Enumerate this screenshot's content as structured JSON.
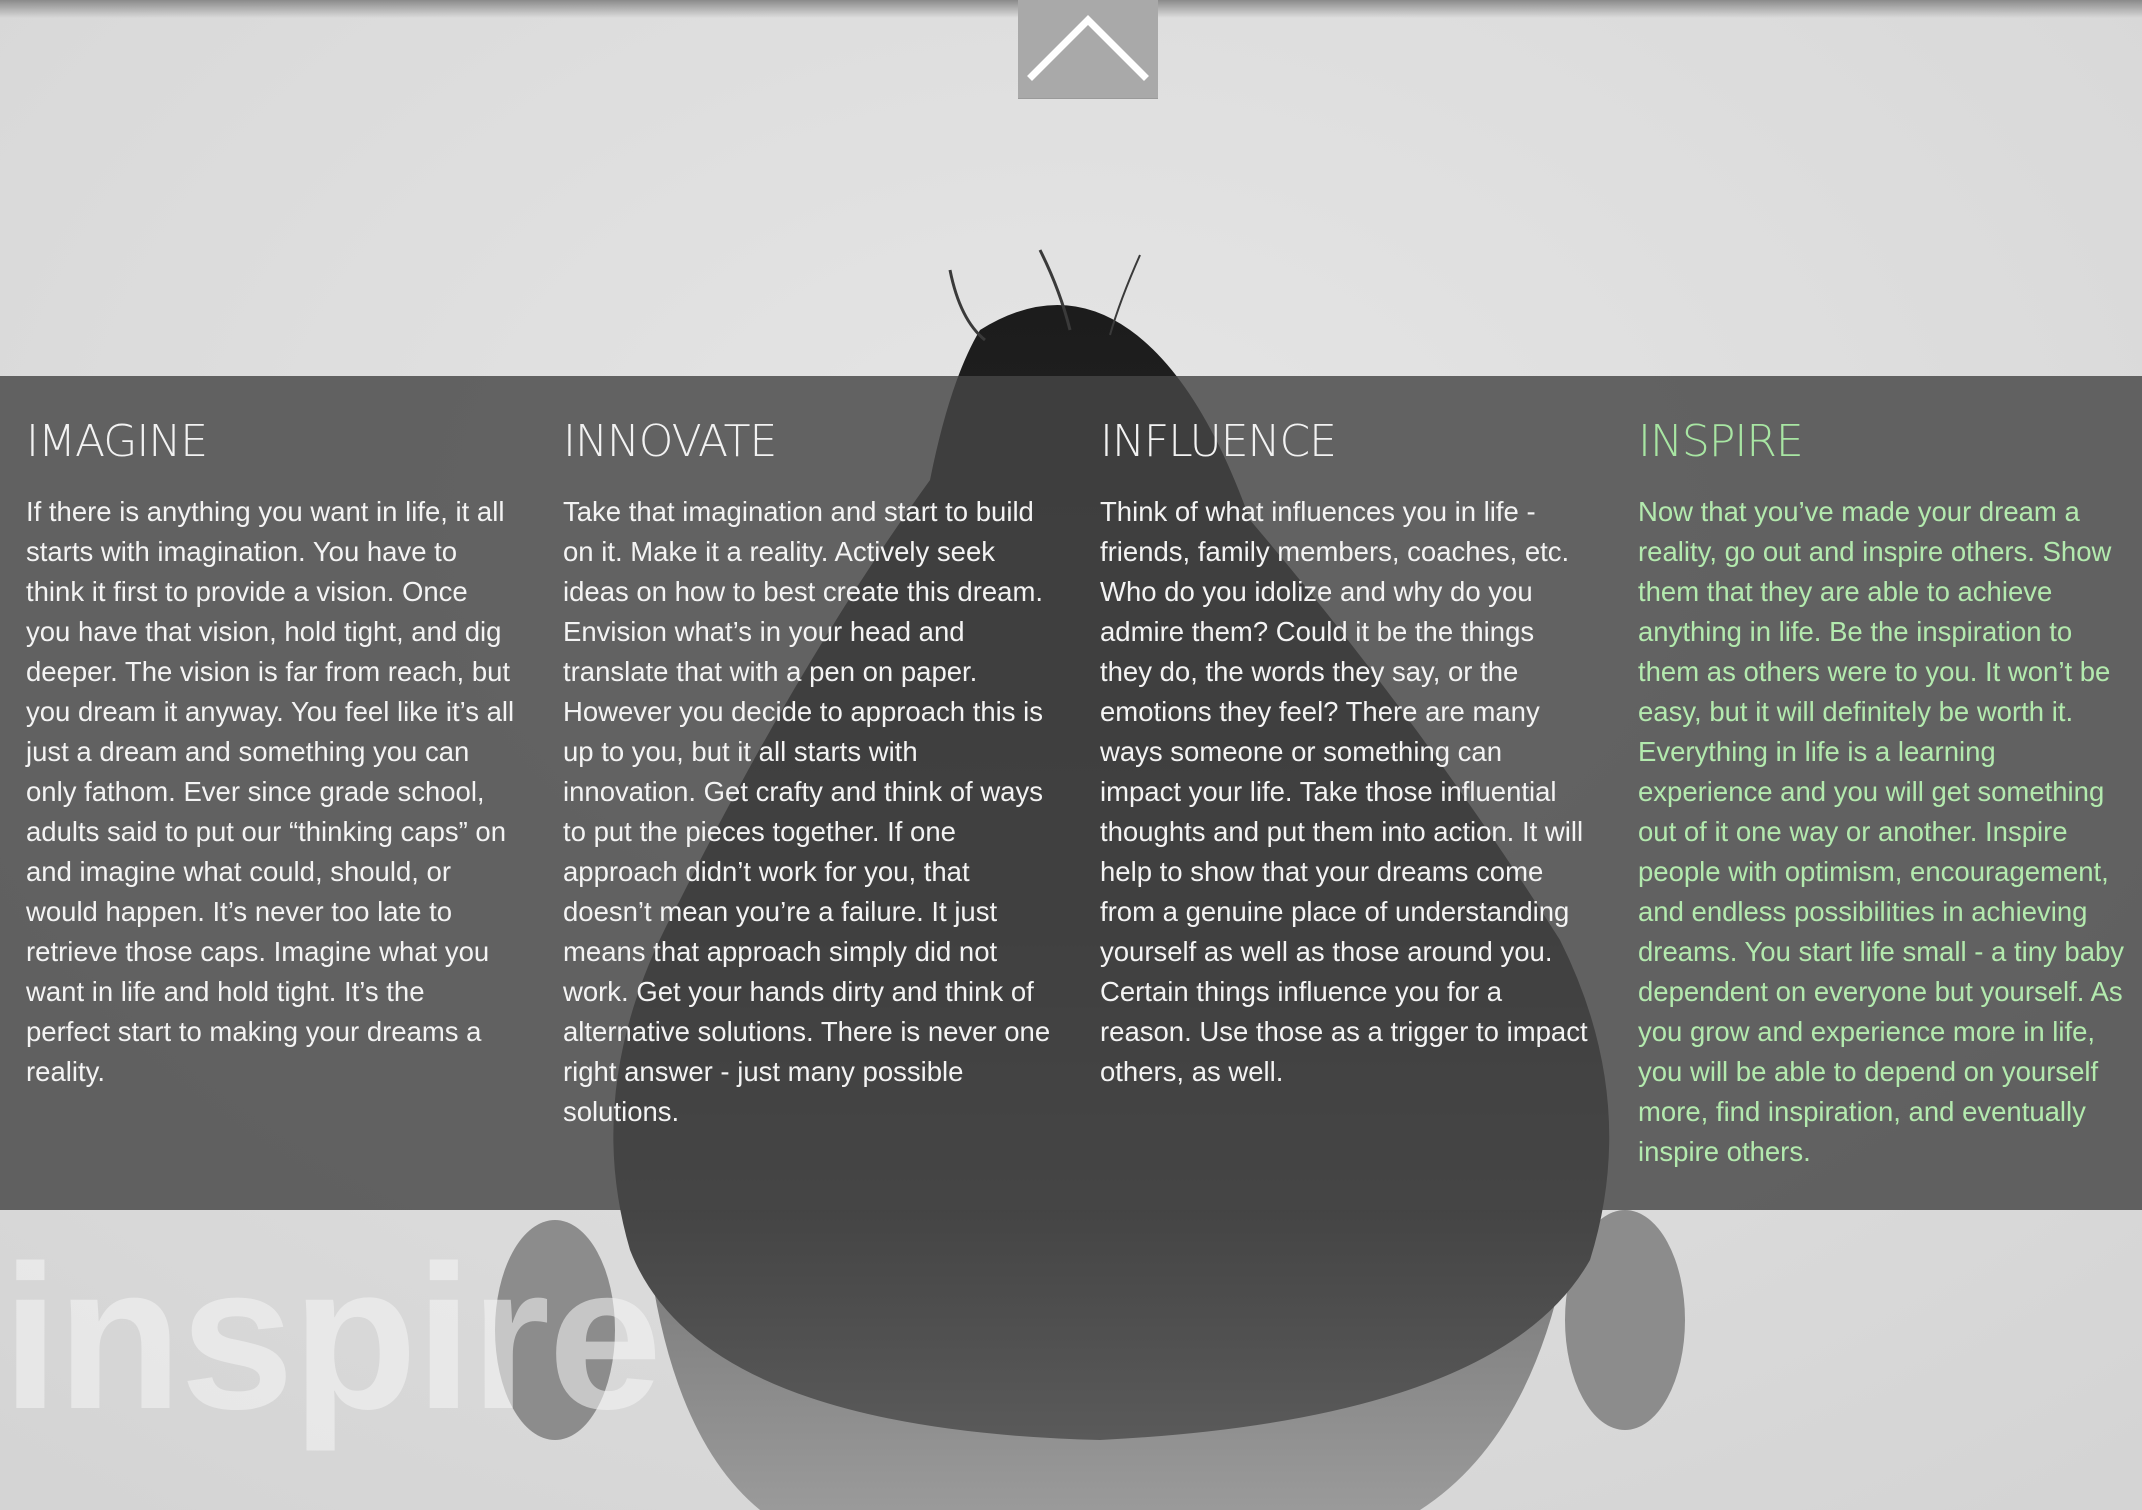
{
  "sections": [
    {
      "heading": "IMAGINE",
      "body": "If there is anything you want in life, it all starts with imagination. You have to think it first to provide a vision. Once you have that vision, hold tight, and dig deeper. The vision is far from reach, but you dream it anyway. You feel like it’s all just a dream and something you can only fathom. Ever since grade school, adults said to put our “thinking caps” on and imagine what could, should, or would happen. It’s never too late to retrieve those caps. Imagine what you want in life and hold tight. It’s the perfect start to making your dreams a reality."
    },
    {
      "heading": "INNOVATE",
      "body": "Take that imagination and start to build on it. Make it a reality. Actively seek ideas on how to best create this dream. Envision what’s in your head and translate that with a pen on paper. However you decide to approach this is up to you, but it all starts with innovation. Get crafty and think of ways to put the pieces together. If one approach didn’t work for you, that doesn’t mean you’re a failure. It just means that approach simply did not work. Get your hands dirty and think of alternative solutions. There is never one right answer - just many possible solutions."
    },
    {
      "heading": "INFLUENCE",
      "body": "Think of what influences you in life - friends, family members, coaches, etc. Who do you idolize and why do you admire them? Could it be the things they do, the words they say, or the emotions they feel? There are many ways someone or something can impact your life. Take those influential thoughts and put them into action. It will help to show that your dreams come from a genuine place of understanding yourself as well as those around you. Certain things influence you for a reason. Use those as a trigger to impact others, as well."
    },
    {
      "heading": "INSPIRE",
      "body": "Now that you’ve made your dream a reality, go out and inspire others. Show them that they are able to achieve anything in life. Be the inspiration to them as others were to you. It won’t be easy, but it will definitely be worth it. Everything in life is a learning experience and you will get something out of it one way or another. Inspire people with optimism, encouragement, and endless possibilities in achieving dreams. You start life small - a tiny baby dependent on everyone but yourself. As you grow and experience more in life, you will be able to depend on yourself more, find inspiration, and eventually inspire others."
    }
  ],
  "watermark": "inspire",
  "icons": {
    "scroll_top": "chevron-up-icon"
  },
  "colors": {
    "band": "#464646",
    "text": "#f4f4f4",
    "accent": "#a8e6a3",
    "button": "#a9a9a9"
  }
}
